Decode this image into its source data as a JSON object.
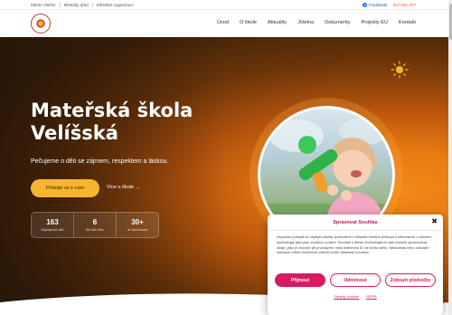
{
  "topbar": {
    "links": [
      "Město Vlašim",
      "Městský úřad",
      "Městské organizace"
    ],
    "facebook_label": "Facebook",
    "phone": "317 842 377"
  },
  "nav": {
    "items": [
      "Úvod",
      "O škole",
      "Aktuality",
      "Jídelna",
      "Dokumenty",
      "Projekty EU",
      "Kontakt"
    ]
  },
  "hero": {
    "title_line1": "Mateřská škola",
    "title_line2": "Velíšská",
    "subtitle": "Pečujeme o děti se zájmem, respektem a láskou.",
    "primary_button": "Přidejte se k nám",
    "secondary_link": "Více o škole →",
    "stats": [
      {
        "value": "163",
        "label": "Zbývajících dětí"
      },
      {
        "value": "6",
        "label": "tříd dle věku"
      },
      {
        "value": "30+",
        "label": "let zkušeností"
      }
    ]
  },
  "cookie": {
    "title": "Spravovat Souhlas",
    "close_glyph": "✖",
    "body": "Abychom poskytli co nejlepší služby, používáme k ukládání a/nebo přístupu k informacím o zařízení, technologie jako jsou soubory cookies. Souhlas s těmito technologiemi nám umožní zpracovávat údaje, jako je chování při procházení nebo jedinečná ID na tomto webu. Nesouhlas nebo odvolání souhlasu může nepříznivě ovlivnit určité vlastnosti a funkce.",
    "accept": "Přijmout",
    "deny": "Odmítnout",
    "prefs": "Zobrazit předvolby",
    "footer_links": [
      "Zásady cookies",
      "GDPR"
    ]
  },
  "colors": {
    "accent_pink": "#d81b60",
    "accent_yellow": "#f6b52d",
    "hero_orange": "#e87a12"
  }
}
